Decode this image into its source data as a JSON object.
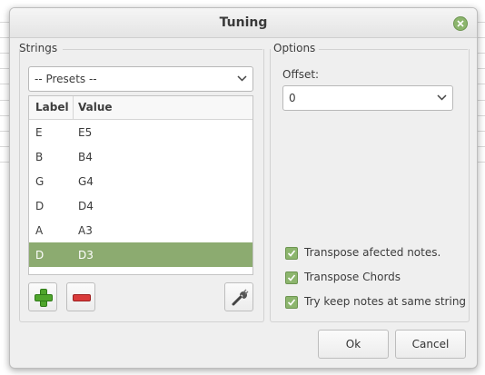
{
  "window": {
    "title": "Tuning"
  },
  "strings_group": {
    "title": "Strings",
    "presets_label": "-- Presets --",
    "columns": {
      "label": "Label",
      "value": "Value"
    },
    "rows": [
      {
        "label": "E",
        "value": "E5"
      },
      {
        "label": "B",
        "value": "B4"
      },
      {
        "label": "G",
        "value": "G4"
      },
      {
        "label": "D",
        "value": "D4"
      },
      {
        "label": "A",
        "value": "A3"
      },
      {
        "label": "D",
        "value": "D3"
      }
    ],
    "selected_row": 5,
    "icons": {
      "add": "plus-icon",
      "remove": "minus-icon",
      "settings": "wrench-icon"
    }
  },
  "options_group": {
    "title": "Options",
    "offset_label": "Offset:",
    "offset_value": "0",
    "checkboxes": [
      {
        "label": "Transpose afected notes.",
        "checked": true
      },
      {
        "label": "Transpose Chords",
        "checked": true
      },
      {
        "label": "Try keep notes at same string",
        "checked": true
      }
    ]
  },
  "buttons": {
    "ok": "Ok",
    "cancel": "Cancel"
  },
  "colors": {
    "accent": "#8cb56d",
    "selection": "#8cab70",
    "window_bg": "#efefef"
  }
}
